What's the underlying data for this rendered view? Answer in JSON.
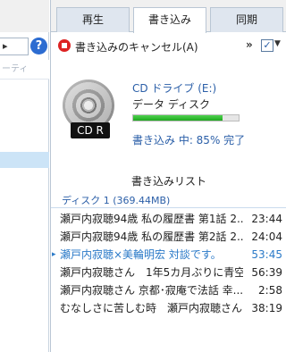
{
  "sidebar": {
    "column_header": "ーティ"
  },
  "tabs": [
    {
      "label": "再生",
      "active": false
    },
    {
      "label": "書き込み",
      "active": true
    },
    {
      "label": "同期",
      "active": false
    }
  ],
  "toolbar": {
    "cancel_label": "書き込みのキャンセル(A)",
    "more_label": "»"
  },
  "drive": {
    "badge": "CD R",
    "name": "CD ドライブ (E:)",
    "type": "データ ディスク",
    "progress_percent": 85,
    "status": "書き込み 中: 85% 完了"
  },
  "burn_list": {
    "title": "書き込みリスト",
    "disc_label": "ディスク 1 (369.44MB)",
    "tracks": [
      {
        "title": "瀬戸内寂聴94歳 私の履歴書 第1話 2...",
        "time": "23:44"
      },
      {
        "title": "瀬戸内寂聴94歳 私の履歴書 第2話 2...",
        "time": "24:04"
      },
      {
        "title": "瀬戸内寂聴×美輪明宏 対談です。",
        "time": "53:45"
      },
      {
        "title": "瀬戸内寂聴さん　1年5カ月ぶりに青空...",
        "time": "56:39"
      },
      {
        "title": "瀬戸内寂聴さん 京都･寂庵で法話 幸...",
        "time": "2:58"
      },
      {
        "title": "むなしさに苦しむ時　瀬戸内寂聴さん",
        "time": "38:19"
      }
    ]
  },
  "colors": {
    "accent": "#2b5fa8",
    "progress": "#1fa81f",
    "stop": "#dd2222",
    "help": "#2c6cd1"
  }
}
